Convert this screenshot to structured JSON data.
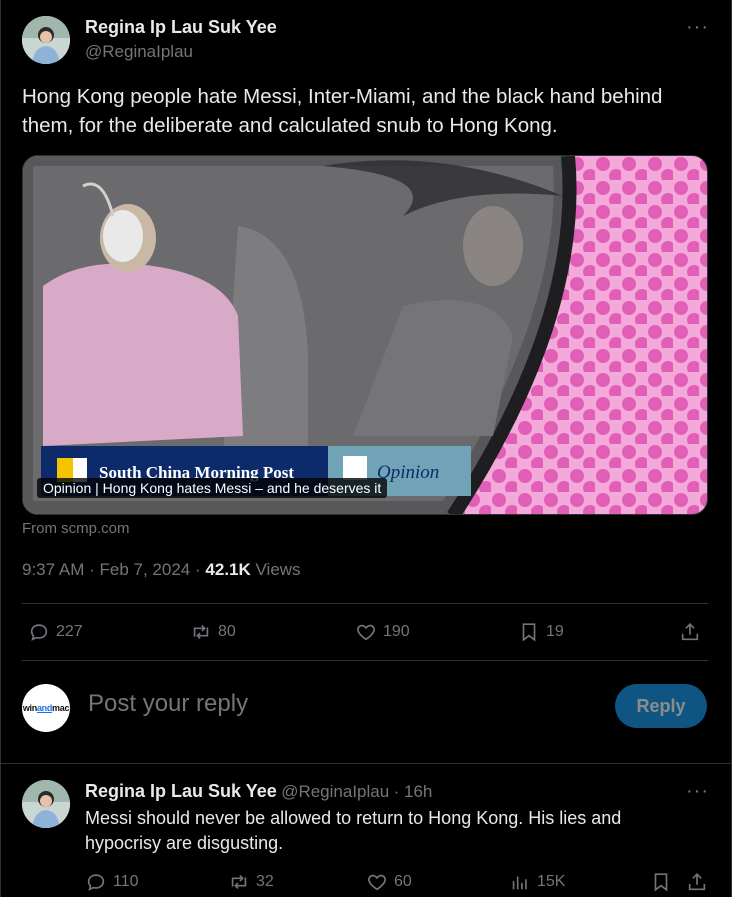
{
  "tweet": {
    "author_name": "Regina Ip Lau Suk Yee",
    "handle": "@ReginaIplau",
    "more": "···",
    "text": "Hong Kong people hate Messi, Inter-Miami, and the black hand behind them, for the deliberate and calculated snub to Hong Kong.",
    "card": {
      "caption": "Opinion | Hong Kong hates Messi – and he deserves it",
      "brand": "South China Morning Post",
      "section": "Opinion",
      "source": "From scmp.com"
    },
    "time": "9:37 AM",
    "date": "Feb 7, 2024",
    "views_count": "42.1K",
    "views_label": "Views",
    "sep": "·",
    "actions": {
      "replies": "227",
      "retweets": "80",
      "likes": "190",
      "bookmarks": "19"
    }
  },
  "compose": {
    "avatar_text_a": "win",
    "avatar_text_b": "and",
    "avatar_text_c": "mac",
    "placeholder": "Post your reply",
    "button": "Reply"
  },
  "reply": {
    "author_name": "Regina Ip Lau Suk Yee",
    "handle": "@ReginaIplau",
    "age": "· 16h",
    "more": "···",
    "text": "Messi should never be allowed to return to Hong Kong. His lies and hypocrisy are disgusting.",
    "actions": {
      "replies": "110",
      "retweets": "32",
      "likes": "60",
      "views": "15K"
    }
  },
  "colors": {
    "background": "#000000",
    "text": "#e7e9ea",
    "muted": "#71767b",
    "accent": "#1d9bf0",
    "border": "#2f3336"
  }
}
